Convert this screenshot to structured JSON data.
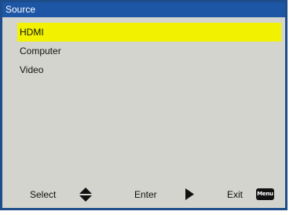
{
  "title": "Source",
  "items": [
    {
      "label": "HDMI",
      "selected": true
    },
    {
      "label": "Computer",
      "selected": false
    },
    {
      "label": "Video",
      "selected": false
    }
  ],
  "footer": {
    "select_label": "Select",
    "select_icon": "up-down-arrows-icon",
    "enter_label": "Enter",
    "enter_icon": "right-triangle-icon",
    "exit_label": "Exit",
    "exit_key": "Menu"
  },
  "colors": {
    "title_bar": "#1e56a6",
    "background": "#d4d4ce",
    "highlight": "#f2f200"
  }
}
